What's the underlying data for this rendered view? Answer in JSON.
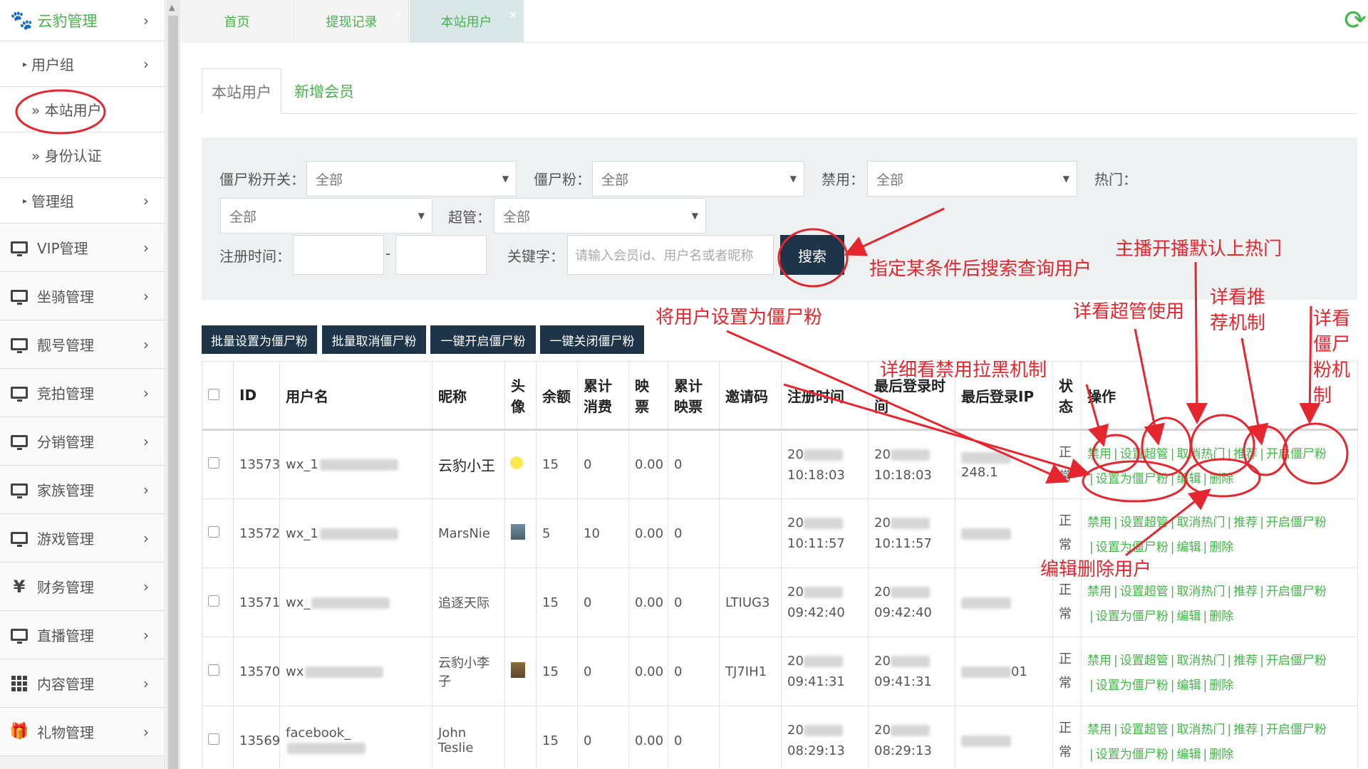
{
  "brand": {
    "title": "云豹管理"
  },
  "sidebar": {
    "sub_items": [
      {
        "label": "用户组"
      },
      {
        "label": "» 本站用户"
      },
      {
        "label": "» 身份认证"
      },
      {
        "label": "管理组"
      }
    ],
    "main_items": [
      {
        "label": "VIP管理",
        "icon": "monitor-icon"
      },
      {
        "label": "坐骑管理",
        "icon": "monitor-icon"
      },
      {
        "label": "靓号管理",
        "icon": "monitor-icon"
      },
      {
        "label": "竞拍管理",
        "icon": "monitor-icon"
      },
      {
        "label": "分销管理",
        "icon": "monitor-icon"
      },
      {
        "label": "家族管理",
        "icon": "monitor-icon"
      },
      {
        "label": "游戏管理",
        "icon": "monitor-icon"
      },
      {
        "label": "财务管理",
        "icon": "yen-icon"
      },
      {
        "label": "直播管理",
        "icon": "monitor-icon"
      },
      {
        "label": "内容管理",
        "icon": "grid-icon"
      },
      {
        "label": "礼物管理",
        "icon": "gift-icon"
      }
    ]
  },
  "top_tabs": [
    {
      "label": "首页"
    },
    {
      "label": "提现记录"
    },
    {
      "label": "本站用户"
    }
  ],
  "content_tabs": [
    {
      "label": "本站用户"
    },
    {
      "label": "新增会员"
    }
  ],
  "filter": {
    "zombie_switch_label": "僵尸粉开关：",
    "zombie_label": "僵尸粉：",
    "ban_label": "禁用：",
    "hot_label": "热门：",
    "super_label": "超管：",
    "regtime_label": "注册时间：",
    "keyword_label": "关键字：",
    "select_value": "全部",
    "date_dash": "-",
    "keyword_placeholder": "请输入会员id、用户名或者昵称",
    "search_label": "搜索"
  },
  "bulk_actions": [
    {
      "label": "批量设置为僵尸粉"
    },
    {
      "label": "批量取消僵尸粉"
    },
    {
      "label": "一键开启僵尸粉"
    },
    {
      "label": "一键关闭僵尸粉"
    }
  ],
  "table": {
    "headers": {
      "id": "ID",
      "username": "用户名",
      "nickname": "昵称",
      "avatar": "头像",
      "balance": "余额",
      "consume": "累计消费",
      "ticket": "映票",
      "total_ticket": "累计映票",
      "invite": "邀请码",
      "regtime": "注册时间",
      "lastlogin": "最后登录时间",
      "lastip": "最后登录IP",
      "status": "状态",
      "ops": "操作"
    },
    "ops_line1": [
      "禁用",
      "设置超管",
      "取消热门",
      "推荐",
      "开启僵尸粉"
    ],
    "ops_line2": [
      "设置为僵尸粉",
      "编辑",
      "删除"
    ],
    "rows": [
      {
        "id": "13573",
        "username": "wx_1",
        "nickname": "云豹小王",
        "avatar": "sun-avatar",
        "balance": "15",
        "consume": "0",
        "ticket": "0.00",
        "total_ticket": "0",
        "invite": "",
        "reg_date": "20",
        "reg_time": "10:18:03",
        "login_date": "20",
        "login_time": "10:18:03",
        "ip_tail": "248.1",
        "status": "正常"
      },
      {
        "id": "13572",
        "username": "wx_1",
        "nickname": "MarsNie",
        "avatar": "photo-avatar",
        "balance": "5",
        "consume": "10",
        "ticket": "0.00",
        "total_ticket": "0",
        "invite": "",
        "reg_date": "20",
        "reg_time": "10:11:57",
        "login_date": "20",
        "login_time": "10:11:57",
        "ip_tail": "",
        "status": "正常"
      },
      {
        "id": "13571",
        "username": "wx_",
        "nickname": "追逐天际",
        "avatar": "",
        "balance": "15",
        "consume": "0",
        "ticket": "0.00",
        "total_ticket": "0",
        "invite": "LTIUG3",
        "reg_date": "20",
        "reg_time": "09:42:40",
        "login_date": "20",
        "login_time": "09:42:40",
        "ip_tail": "",
        "status": "正常"
      },
      {
        "id": "13570",
        "username": "wx",
        "nickname": "云豹小李子",
        "avatar": "photo-avatar-2",
        "balance": "15",
        "consume": "0",
        "ticket": "0.00",
        "total_ticket": "0",
        "invite": "TJ7IH1",
        "reg_date": "20",
        "reg_time": "09:41:31",
        "login_date": "20",
        "login_time": "09:41:31",
        "ip_tail": "01",
        "status": "正常"
      },
      {
        "id": "13569",
        "username": "facebook_",
        "nickname": "John Teslie",
        "avatar": "",
        "balance": "15",
        "consume": "0",
        "ticket": "0.00",
        "total_ticket": "0",
        "invite": "",
        "reg_date": "20",
        "reg_time": "08:29:13",
        "login_date": "20",
        "login_time": "08:29:13",
        "ip_tail": "",
        "status": "正常"
      }
    ]
  },
  "annotations": {
    "search": "指定某条件后搜索查询用户",
    "hot": "主播开播默认上热门",
    "set_zombie": "将用户设置为僵尸粉",
    "super": "详看超管使用",
    "recommend": "详看推荐机制",
    "ban": "详细看禁用拉黑机制",
    "zombie_mech": "详看僵尸粉机制",
    "edit_delete": "编辑删除用户"
  },
  "colors": {
    "accent": "#44b549",
    "dark_button": "#1e3448",
    "annotation": "#e6262e"
  }
}
